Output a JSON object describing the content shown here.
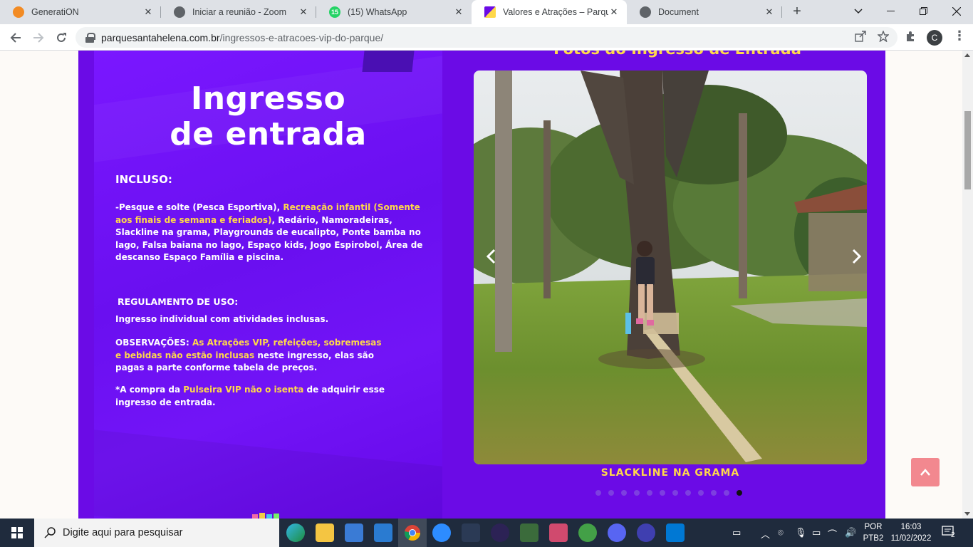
{
  "browser": {
    "tabs": [
      {
        "label": "GeneratiON",
        "icon": "cloud-icon",
        "color": "#f28b24"
      },
      {
        "label": "Iniciar a reunião - Zoom",
        "icon": "globe-icon",
        "color": "#5f6368"
      },
      {
        "label": "(15) WhatsApp",
        "icon": "whatsapp-icon",
        "color": "#25d366",
        "badge": "15"
      },
      {
        "label": "Valores e Atrações – Parque S",
        "icon": "parque-favicon-icon",
        "color": "#6b0be6",
        "active": true
      },
      {
        "label": "Document",
        "icon": "globe-icon",
        "color": "#5f6368"
      }
    ],
    "url_domain": "parquesantahelena.com.br",
    "url_path": "/ingressos-e-atracoes-vip-do-parque/",
    "profile_initial": "C"
  },
  "page": {
    "flyer": {
      "title_line1": "Ingresso",
      "title_line2": "de entrada",
      "incluso_heading": "INCLUSO:",
      "incluso": {
        "p1": "-Pesque e solte ",
        "p2": "(Pesca Esportiva)",
        "p3": ", ",
        "p4": "Recreação infantil",
        "p5": "(Somente aos finais de semana e feriados)",
        "p6": ", Redário, Namoradeiras, Slackline na grama, Playgrounds de eucalipto, Ponte bamba no lago, Falsa baiana no lago, Espaço kids, Jogo Espirobol, Área de descanso ",
        "p7": "Espaço Família",
        "p8": " e piscina."
      },
      "regulamento_heading": "REGULAMENTO DE USO:",
      "regulamento_body": "Ingresso individual com atividades inclusas.",
      "obs": {
        "label": "OBSERVAÇÕES: ",
        "highlight": "As Atrações VIP, refeições, sobremesas e bebidas não estão inclusas",
        "rest": " neste ingresso, elas são pagas a parte conforme tabela de preços."
      },
      "note": {
        "p1": "*A compra da ",
        "p2": "Pulseira VIP",
        "p3": " ",
        "p4": "não o isenta",
        "p5": " de adquirir esse ingresso de entrada."
      }
    },
    "gallery": {
      "title": "Fotos do Ingresso de Entrada",
      "caption": "SLACKLINE NA GRAMA",
      "prev_icon": "chevron-left-icon",
      "next_icon": "chevron-right-icon",
      "slide_count": 12,
      "active_slide": 12
    },
    "back_to_top_icon": "chevron-up-icon"
  },
  "taskbar": {
    "search_placeholder": "Digite aqui para pesquisar",
    "lang_line1": "POR",
    "lang_line2": "PTB2",
    "time": "16:03",
    "date": "11/02/2022",
    "notification_count": "2"
  },
  "colors": {
    "page_purple": "#6b0be6",
    "accent_yellow": "#ffd84a",
    "back_to_top": "#f2888f"
  }
}
